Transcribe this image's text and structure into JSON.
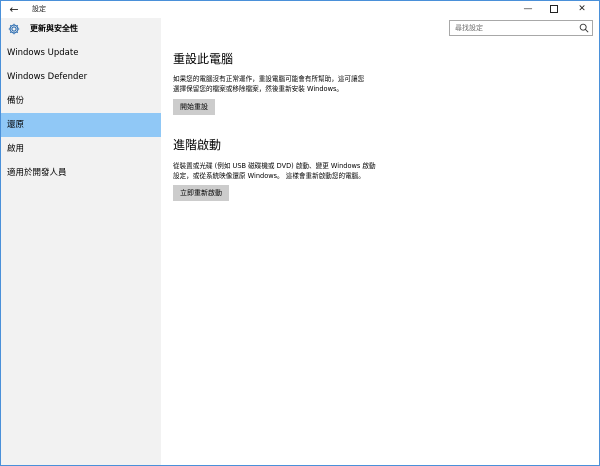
{
  "window": {
    "title": "設定",
    "back": "←",
    "minimize": "—",
    "close": "✕"
  },
  "sidebar": {
    "section_title": "更新與安全性",
    "items": [
      {
        "label": "Windows Update"
      },
      {
        "label": "Windows Defender"
      },
      {
        "label": "備份"
      },
      {
        "label": "還原",
        "selected": true
      },
      {
        "label": "啟用"
      },
      {
        "label": "適用於開發人員"
      }
    ]
  },
  "search": {
    "placeholder": "尋找設定"
  },
  "main": {
    "reset": {
      "heading": "重設此電腦",
      "line1": "如果您的電腦沒有正常運作，重設電腦可能會有所幫助，這可讓您",
      "line2": "選擇保留您的檔案或移除檔案，然後重新安裝 Windows。",
      "button": "開始重設"
    },
    "advanced": {
      "heading": "進階啟動",
      "line1": "從裝置或光碟 (例如 USB 磁碟機或 DVD) 啟動、變更 Windows 啟動",
      "line2": "設定，或從系統映像還原 Windows。 這樣會重新啟動您的電腦。",
      "button": "立即重新啟動"
    }
  },
  "colors": {
    "selected_bg": "#90c8f6",
    "sidebar_bg": "#f2f2f2",
    "button_bg": "#cccccc",
    "window_border": "#4a90d9"
  }
}
